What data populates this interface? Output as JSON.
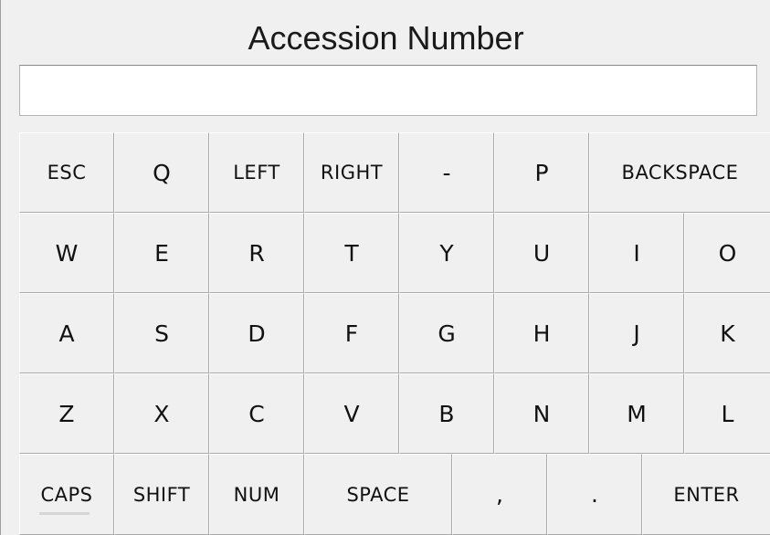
{
  "window": {
    "title": "Accession Number"
  },
  "input": {
    "value": "",
    "placeholder": ""
  },
  "keyboard": {
    "row1": {
      "esc": "ESC",
      "q": "Q",
      "left": "LEFT",
      "right": "RIGHT",
      "dash": "-",
      "p": "P",
      "backspace": "BACKSPACE"
    },
    "row2": [
      "W",
      "E",
      "R",
      "T",
      "Y",
      "U",
      "I",
      "O"
    ],
    "row3": [
      "A",
      "S",
      "D",
      "F",
      "G",
      "H",
      "J",
      "K"
    ],
    "row4": [
      "Z",
      "X",
      "C",
      "V",
      "B",
      "N",
      "M",
      "L"
    ],
    "row5": {
      "caps": "CAPS",
      "shift": "SHIFT",
      "num": "NUM",
      "space": "SPACE",
      "comma": ",",
      "period": ".",
      "enter": "ENTER"
    }
  }
}
